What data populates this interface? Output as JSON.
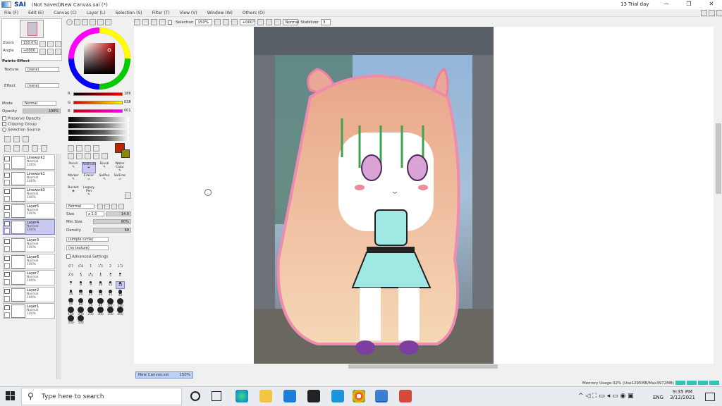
{
  "app": {
    "name": "SAI",
    "title": "(Not Saved)New Canvas.sai (*)",
    "trial": "13 Trial day"
  },
  "window_controls": {
    "minimize": "—",
    "maximize": "❐",
    "close": "✕"
  },
  "menu": [
    "File (F)",
    "Edit (E)",
    "Canvas (C)",
    "Layer (L)",
    "Selection (S)",
    "Filter (T)",
    "View (V)",
    "Window (W)",
    "Others (O)"
  ],
  "toolbar": {
    "selection_label": "Selection",
    "zoom": "150%",
    "rotation": "+000°",
    "mode": "Normal",
    "stabilizer_label": "Stabilizer",
    "stabilizer_value": "3"
  },
  "navigator": {
    "zoom_label": "Zoom",
    "zoom_value": "150.0%",
    "angle_label": "Angle",
    "angle_value": "+0000"
  },
  "paper_effect": {
    "header": "Paints Effect",
    "texture_label": "Texture",
    "texture_value": "(none)",
    "effect_label": "Effect",
    "effect_value": "(none)"
  },
  "layer_options": {
    "mode_label": "Mode",
    "mode_value": "Normal",
    "opacity_label": "Opacity",
    "opacity_value": "100%",
    "preserve": "Preserve Opacity",
    "clipping": "Clipping Group",
    "selection_source": "Selection Source"
  },
  "layers": [
    {
      "name": "Linework2",
      "mode": "Normal",
      "opacity": "100%",
      "selected": false
    },
    {
      "name": "Linework1",
      "mode": "Normal",
      "opacity": "100%",
      "selected": false
    },
    {
      "name": "Linework3",
      "mode": "Normal",
      "opacity": "100%",
      "selected": false
    },
    {
      "name": "Layer5",
      "mode": "Normal",
      "opacity": "100%",
      "selected": false
    },
    {
      "name": "Layer4",
      "mode": "Normal",
      "opacity": "100%",
      "selected": true
    },
    {
      "name": "Layer3",
      "mode": "Normal",
      "opacity": "100%",
      "selected": false
    },
    {
      "name": "Layer6",
      "mode": "Normal",
      "opacity": "100%",
      "selected": false
    },
    {
      "name": "Layer7",
      "mode": "Normal",
      "opacity": "100%",
      "selected": false
    },
    {
      "name": "Layer2",
      "mode": "Normal",
      "opacity": "100%",
      "selected": false
    },
    {
      "name": "Layer1",
      "mode": "Normal",
      "opacity": "100%",
      "selected": false
    }
  ],
  "color": {
    "r_label": "R",
    "g_label": "G",
    "b_label": "B",
    "r": "186",
    "g": "038",
    "b": "001",
    "current": "#ba2601",
    "secondary": "#8a8a00"
  },
  "tools": [
    "Pencil",
    "AirBrush",
    "Brush",
    "Water Color",
    "Marker",
    "Eraser",
    "SelPen",
    "SelEras",
    "Bucket",
    "Legacy Pen"
  ],
  "brush": {
    "mode": "Normal",
    "size_label": "Size",
    "size_mult": "x 1.0",
    "size_value": "14.0",
    "minsize_label": "Min Size",
    "minsize_value": "80%",
    "density_label": "Density",
    "density_value": "69",
    "shape": "(simple circle)",
    "texture": "(no texture)",
    "advanced": "Advanced Settings"
  },
  "brush_sizes": [
    "0.7",
    "0.8",
    "1",
    "1.5",
    "2",
    "2.3",
    "2.6",
    "3",
    "3.5",
    "4",
    "5",
    "6",
    "7",
    "8",
    "9",
    "10",
    "12",
    "14",
    "16",
    "20",
    "25",
    "30",
    "35",
    "40",
    "50",
    "60",
    "70",
    "80",
    "100",
    "120",
    "160",
    "200",
    "250",
    "300",
    "350",
    "400",
    "450",
    "500"
  ],
  "doc_tab": {
    "name": "New Canvas.sai",
    "zoom": "150%"
  },
  "status": {
    "memory": "Memory Usage:32% (Use1295MB/Max3972MB)"
  },
  "taskbar": {
    "search_placeholder": "Type here to search",
    "time": "9:35 PM",
    "date": "3/12/2021",
    "lang": "ENG"
  },
  "colors": {
    "accent": "#1c5fd4",
    "selection": "#c8c8f0"
  }
}
